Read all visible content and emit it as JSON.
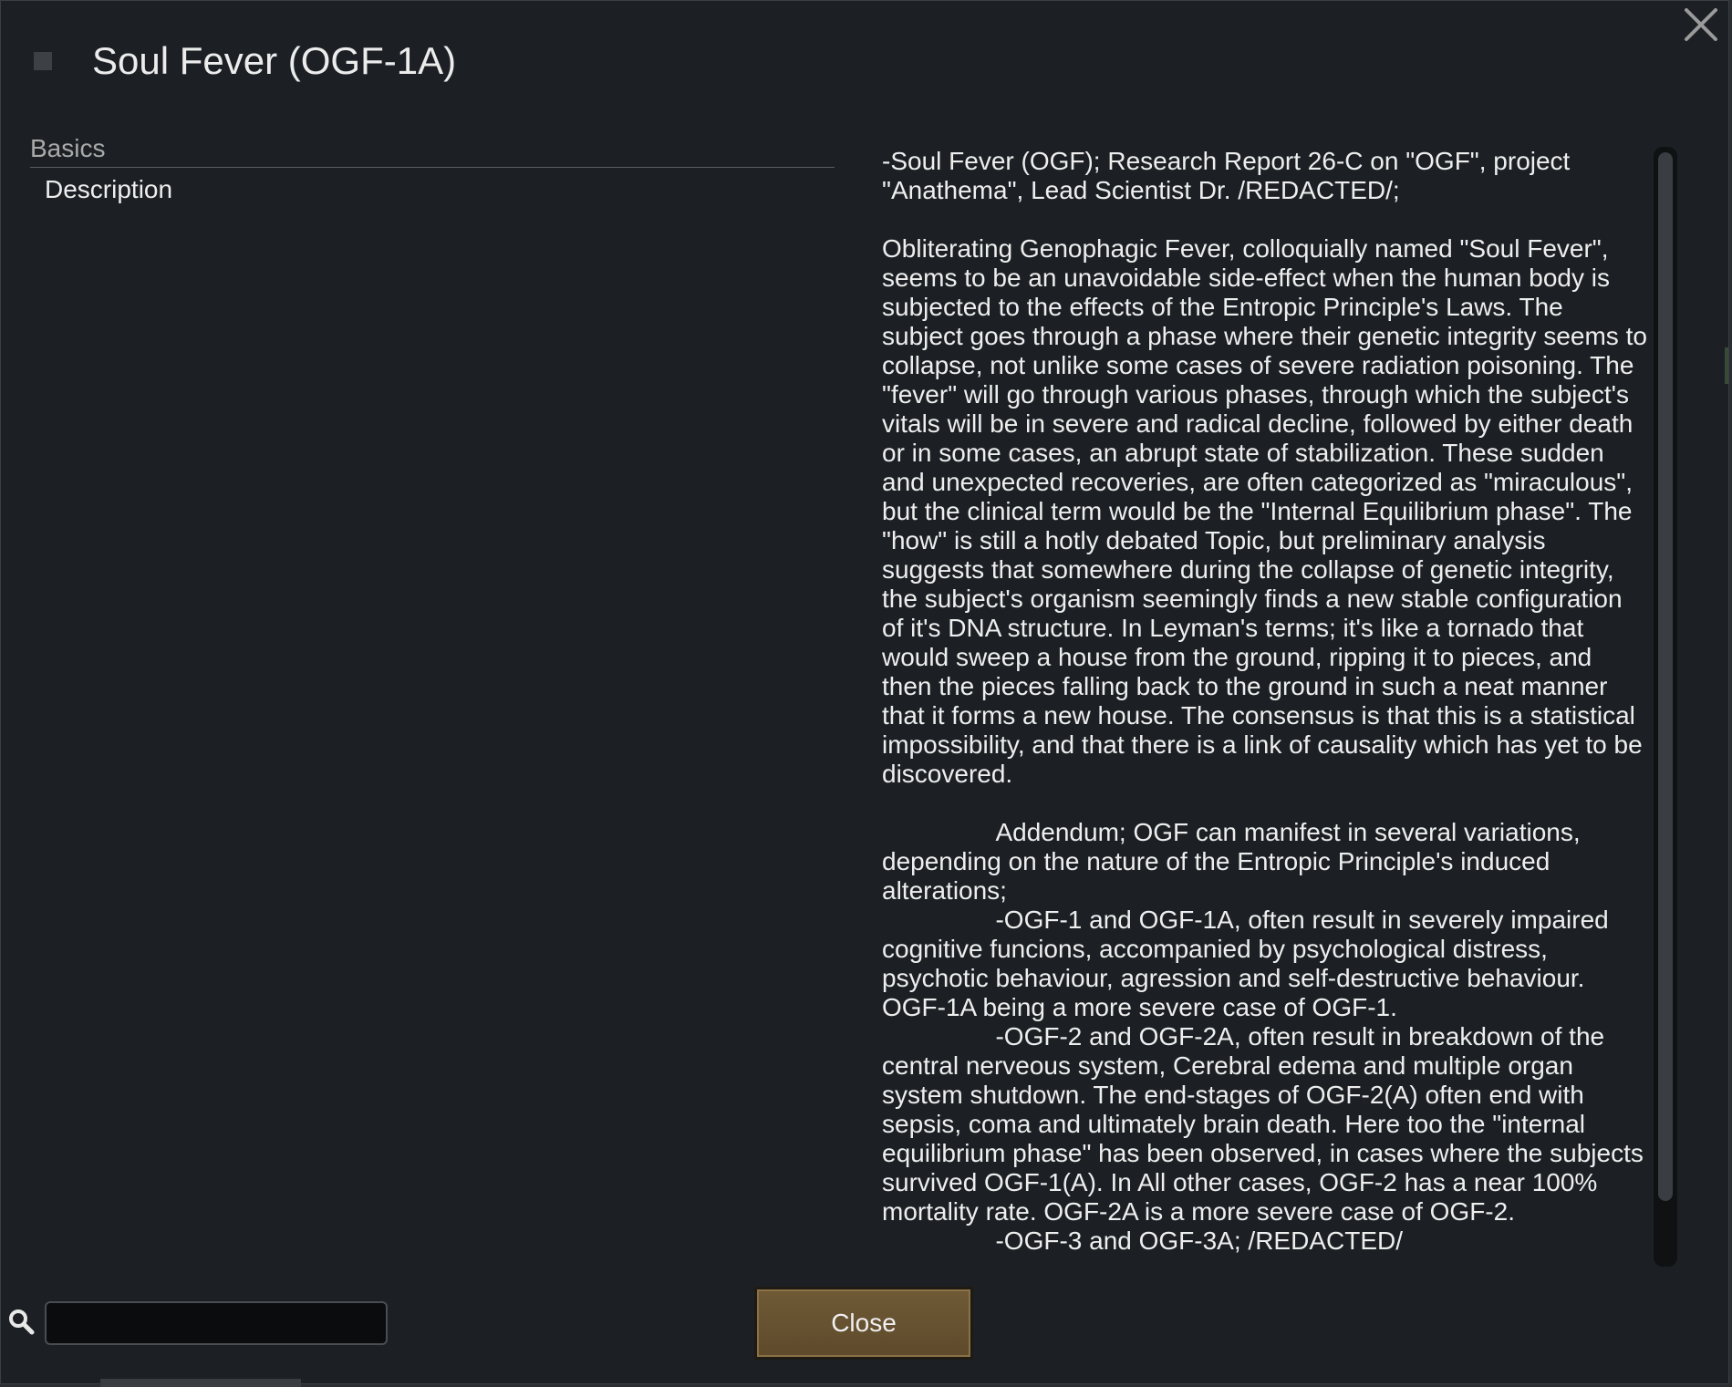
{
  "dialog": {
    "title": "Soul Fever (OGF-1A)",
    "close_icon": "close-x-icon",
    "header_icon": "square-icon"
  },
  "categories": {
    "header": "Basics",
    "items": [
      "Description"
    ]
  },
  "description": "-Soul Fever (OGF); Research Report 26-C on \"OGF\", project \"Anathema\", Lead Scientist Dr. /REDACTED/;\n\nObliterating Genophagic Fever, colloquially named \"Soul Fever\", seems to be an unavoidable side-effect when the human body is subjected to the effects of the Entropic Principle's Laws. The subject goes through a phase where their genetic integrity seems to collapse, not unlike some cases of severe radiation poisoning. The \"fever\" will go through various phases, through which the subject's vitals will be in severe and radical decline, followed by either death or in some cases, an abrupt state of stabilization. These sudden and unexpected recoveries, are often categorized as \"miraculous\", but the clinical term would be the \"Internal Equilibrium phase\". The \"how\" is still a hotly debated Topic, but preliminary analysis suggests that somewhere during the collapse of genetic integrity, the subject's organism seemingly finds a new stable configuration of it's DNA structure. In Leyman's terms; it's like a tornado that would sweep a house from the ground, ripping it to pieces, and then the pieces falling back to the ground in such a neat manner that it forms a new house. The consensus is that this is a statistical impossibility, and that there is a link of causality which has yet to be discovered.\n\n\t\tAddendum; OGF can manifest in several variations, depending on the nature of the Entropic Principle's induced alterations;\n\t\t-OGF-1 and OGF-1A, often result in severely impaired cognitive funcions, accompanied by psychological distress, psychotic behaviour, agression and self-destructive behaviour. OGF-1A being a more severe case of OGF-1.\n\t\t-OGF-2 and OGF-2A, often result in breakdown of the central nerveous system, Cerebral edema and multiple organ system shutdown. The end-stages of OGF-2(A) often end with sepsis, coma and ultimately brain death. Here too the \"internal equilibrium phase\" has been observed, in cases where the subjects survived OGF-1(A). In All other cases, OGF-2 has a near 100% mortality rate. OGF-2A is a more severe case of OGF-2.\n\t\t-OGF-3 and OGF-3A; /REDACTED/",
  "search": {
    "value": "",
    "placeholder": "",
    "icon": "search-icon"
  },
  "buttons": {
    "close_label": "Close"
  },
  "colors": {
    "background": "#1c2024",
    "text": "#eeeeee",
    "muted": "#a9a9a9",
    "button": "#6a5633"
  }
}
